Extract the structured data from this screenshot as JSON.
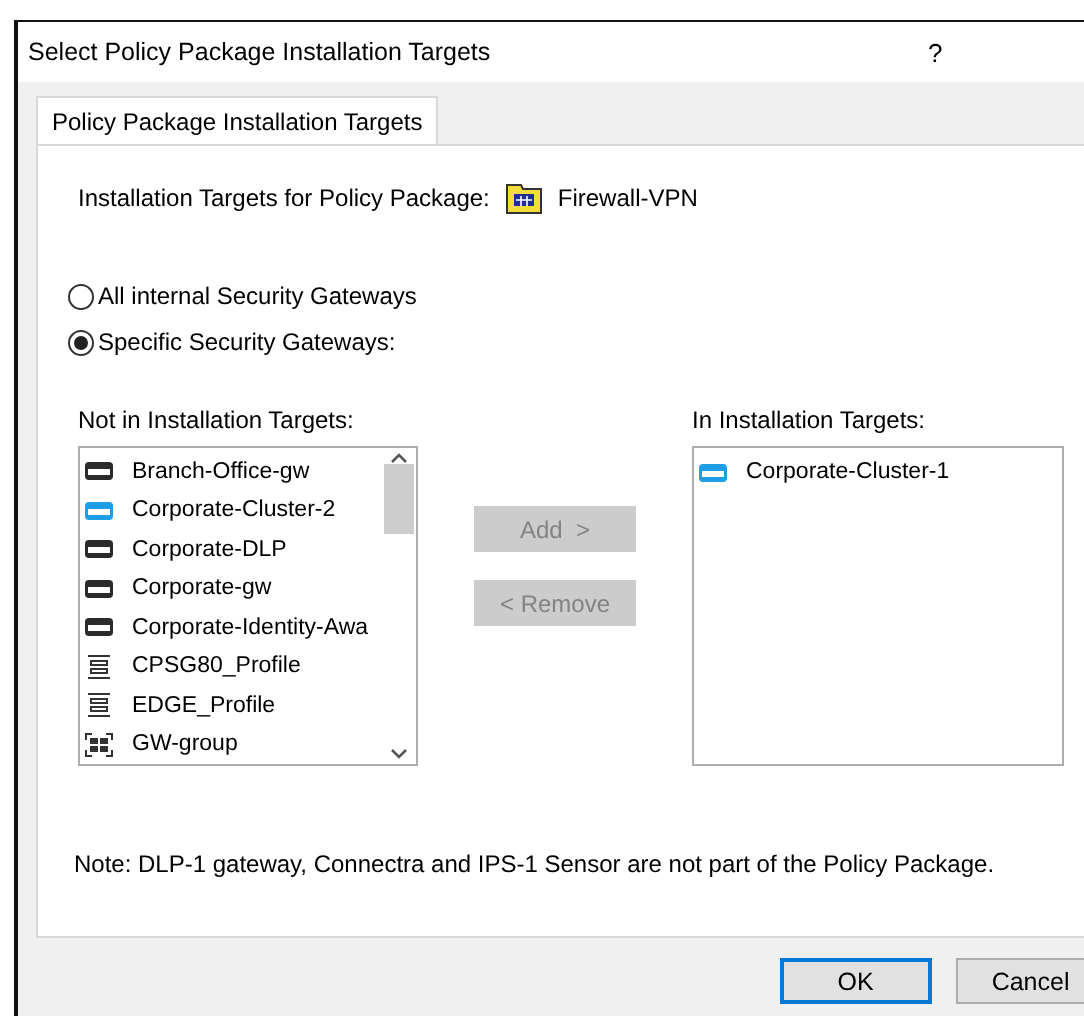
{
  "window": {
    "title": "Select Policy Package Installation Targets",
    "help": "?"
  },
  "tabs": [
    {
      "label": "Policy Package Installation Targets",
      "selected": true
    }
  ],
  "package": {
    "label": "Installation Targets for Policy Package:",
    "name": "Firewall-VPN"
  },
  "scope": [
    {
      "label": "All internal Security Gateways",
      "selected": false
    },
    {
      "label": "Specific Security Gateways:",
      "selected": true
    }
  ],
  "available": {
    "label": "Not in Installation Targets:",
    "items": [
      {
        "name": "Branch-Office-gw",
        "kind": "gateway"
      },
      {
        "name": "Corporate-Cluster-2",
        "kind": "cluster"
      },
      {
        "name": "Corporate-DLP",
        "kind": "gateway"
      },
      {
        "name": "Corporate-gw",
        "kind": "gateway"
      },
      {
        "name": "Corporate-Identity-Awa",
        "kind": "gateway"
      },
      {
        "name": "CPSG80_Profile",
        "kind": "profile"
      },
      {
        "name": "EDGE_Profile",
        "kind": "profile"
      },
      {
        "name": "GW-group",
        "kind": "group"
      }
    ]
  },
  "move_buttons": [
    {
      "label": "Add  >",
      "disabled": true
    },
    {
      "label": "< Remove",
      "disabled": true
    }
  ],
  "targets": {
    "label": "In Installation Targets:",
    "items": [
      {
        "name": "Corporate-Cluster-1",
        "kind": "cluster"
      }
    ]
  },
  "note": "Note: DLP-1 gateway, Connectra and IPS-1 Sensor are not part of the Policy Package.",
  "buttons": [
    {
      "label": "OK",
      "default": true
    },
    {
      "label": "Cancel",
      "default": false
    }
  ]
}
